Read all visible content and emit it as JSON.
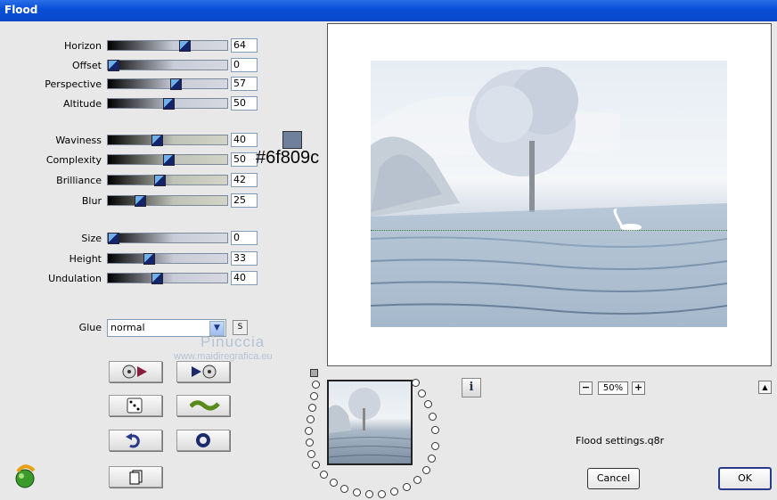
{
  "window": {
    "title": "Flood"
  },
  "sliders": [
    {
      "label": "Horizon",
      "value": "64"
    },
    {
      "label": "Offset",
      "value": "0"
    },
    {
      "label": "Perspective",
      "value": "57"
    },
    {
      "label": "Altitude",
      "value": "50"
    },
    {
      "label": "Waviness",
      "value": "40"
    },
    {
      "label": "Complexity",
      "value": "50"
    },
    {
      "label": "Brilliance",
      "value": "42"
    },
    {
      "label": "Blur",
      "value": "25"
    },
    {
      "label": "Size",
      "value": "0"
    },
    {
      "label": "Height",
      "value": "33"
    },
    {
      "label": "Undulation",
      "value": "40"
    }
  ],
  "color": {
    "swatch": "#6f809c",
    "hex_label": "#6f809c"
  },
  "glue": {
    "label": "Glue",
    "selected": "normal",
    "s_button": "S"
  },
  "watermark": {
    "name": "Pinuccia",
    "url": "www.maidiregrafica.eu"
  },
  "icons": {
    "play_right": "disc-play-right-icon",
    "play_left": "disc-play-left-icon",
    "dice": "dice-icon",
    "wave": "wave-icon",
    "undo": "undo-icon",
    "reset": "ring-icon",
    "copy": "copy-icon",
    "app": "app-logo-icon",
    "info": "info-icon"
  },
  "preview": {
    "info_label": "i",
    "zoom_out": "−",
    "zoom_in": "+",
    "zoom": "50%",
    "scroll_up": "▲"
  },
  "status": {
    "file": "Flood settings.q8r"
  },
  "buttons": {
    "cancel": "Cancel",
    "ok": "OK"
  }
}
